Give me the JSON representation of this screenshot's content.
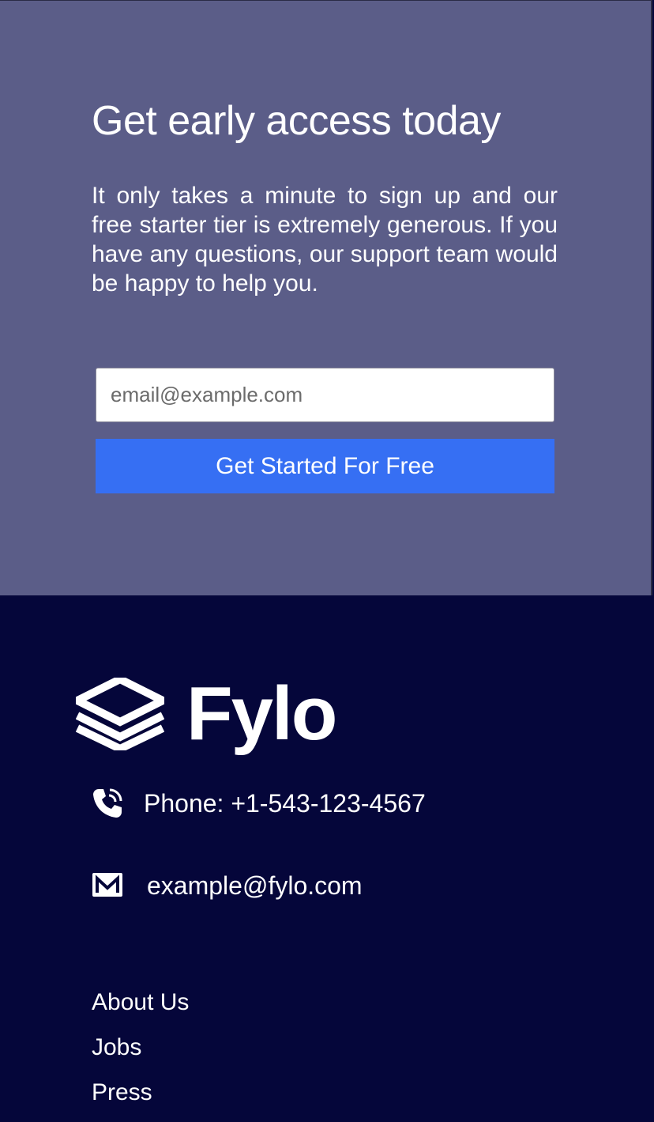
{
  "signup": {
    "title": "Get early access today",
    "description": "It only takes a minute to sign up and our free starter tier is extremely generous. If you have any questions, our support team would be happy to help you.",
    "email_placeholder": "email@example.com",
    "button_label": "Get Started For Free"
  },
  "footer": {
    "logo_text": "Fylo",
    "phone": "Phone: +1-543-123-4567",
    "email": "example@fylo.com",
    "links": [
      "About Us",
      "Jobs",
      "Press"
    ]
  },
  "colors": {
    "signup_bg": "#5b5d88",
    "footer_bg": "#05063a",
    "accent": "#366ff3"
  },
  "icons": {
    "logo": "layers-icon",
    "phone": "phone-icon",
    "email": "mail-icon"
  }
}
